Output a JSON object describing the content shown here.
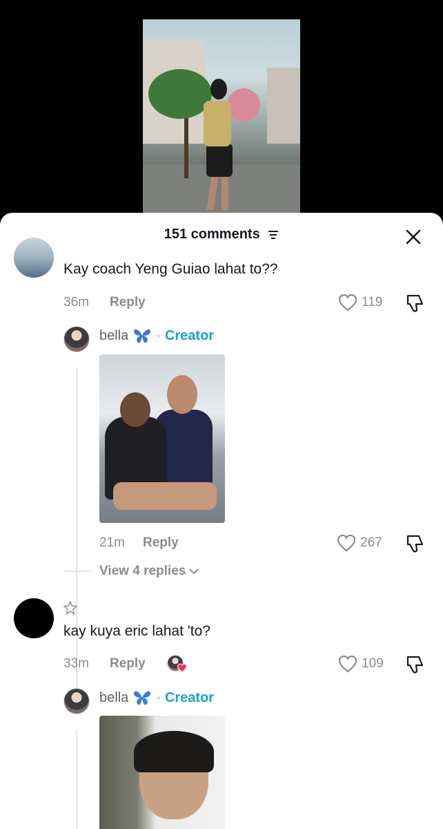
{
  "header": {
    "comment_count": "151 comments"
  },
  "comments": [
    {
      "text": "Kay coach Yeng Guiao lahat to??",
      "time": "36m",
      "reply_label": "Reply",
      "likes": "119",
      "replies": {
        "author": "bella",
        "creator_label": "Creator",
        "dot": "·",
        "time": "21m",
        "reply_label": "Reply",
        "likes": "267",
        "view_more": "View 4 replies"
      }
    },
    {
      "text": "kay kuya eric lahat 'to?",
      "time": "33m",
      "reply_label": "Reply",
      "likes": "109",
      "replies": {
        "author": "bella",
        "creator_label": "Creator",
        "dot": "·"
      }
    }
  ],
  "colors": {
    "creator": "#1aa3c8",
    "muted": "#8a8b91",
    "heart_badge": "#fe2c55"
  },
  "icons": [
    "sort-icon",
    "close-icon",
    "heart-icon",
    "dislike-icon",
    "butterfly-emoji",
    "star-icon",
    "chevron-down-icon"
  ]
}
